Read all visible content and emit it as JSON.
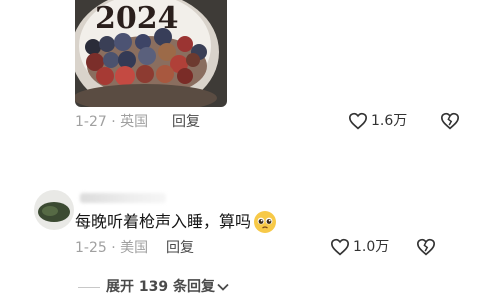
{
  "comment1": {
    "image_label": "2024",
    "meta": "1-27 · 英国",
    "reply": "回复",
    "likes": "1.6万"
  },
  "comment2": {
    "text": "每晚听着枪声入睡，算吗",
    "meta": "1-25 · 美国",
    "reply": "回复",
    "likes": "1.0万"
  },
  "expand_replies": "展开 139 条回复",
  "icons": {
    "like": "heart-outline-icon",
    "dislike": "broken-heart-icon",
    "emoji": "pleading-face-emoji",
    "chevron": "chevron-down-icon"
  }
}
